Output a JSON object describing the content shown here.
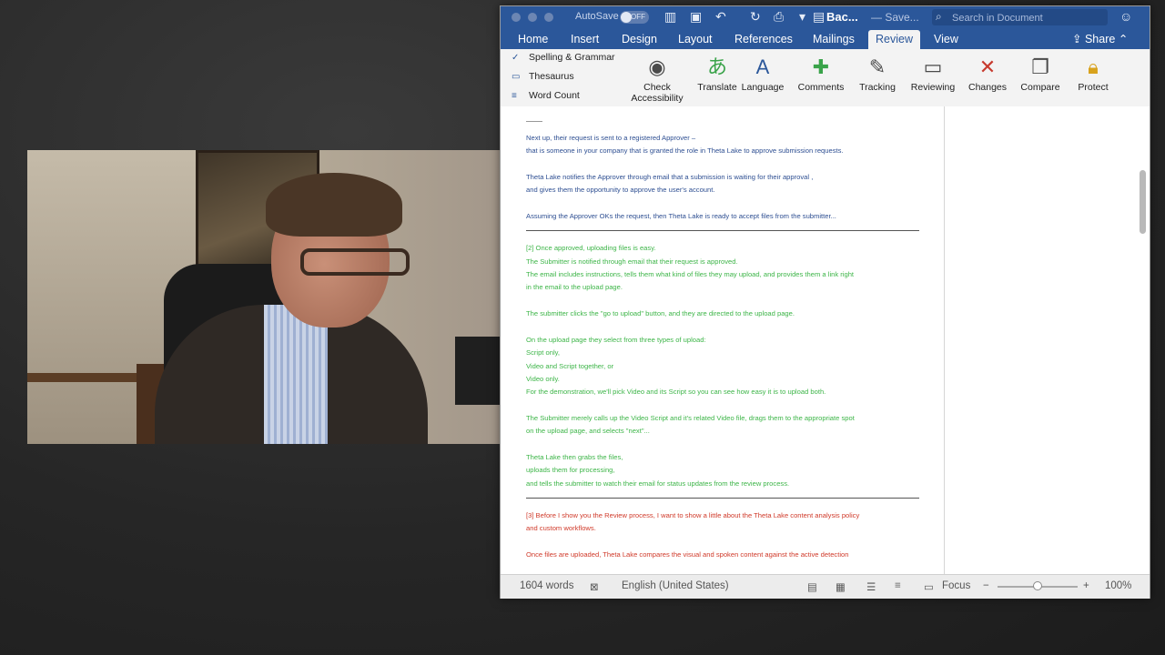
{
  "titlebar": {
    "autosave_label": "AutoSave",
    "autosave_state": "OFF",
    "doc_title": "Bac...",
    "doc_status": "— Save...",
    "search_placeholder": "Search in Document"
  },
  "tabs": [
    {
      "label": "Home"
    },
    {
      "label": "Insert"
    },
    {
      "label": "Design"
    },
    {
      "label": "Layout"
    },
    {
      "label": "References"
    },
    {
      "label": "Mailings"
    },
    {
      "label": "Review"
    },
    {
      "label": "View"
    }
  ],
  "share_label": "Share",
  "proofing": {
    "spelling": "Spelling & Grammar",
    "thesaurus": "Thesaurus",
    "word_count": "Word Count"
  },
  "ribbon": {
    "check_accessibility_1": "Check",
    "check_accessibility_2": "Accessibility",
    "translate": "Translate",
    "language": "Language",
    "comments": "Comments",
    "tracking": "Tracking",
    "reviewing": "Reviewing",
    "changes": "Changes",
    "compare": "Compare",
    "protect": "Protect"
  },
  "document": {
    "blue": [
      "Next up, their request is sent to a registered Approver –",
      "that is someone in your company that is granted the role in Theta Lake to approve submission requests.",
      "Theta Lake notifies the Approver through email that a submission is waiting for their approval ,",
      "and gives them the opportunity to approve the user's account.",
      "Assuming the Approver OKs the request, then Theta Lake is ready to accept files from the submitter..."
    ],
    "green": [
      "[2] Once approved, uploading files is easy.",
      "The Submitter is notified through email that their request is approved.",
      "The email includes instructions, tells them what kind of files they may upload, and provides them a link right",
      "in the email to the upload page.",
      "The submitter clicks the \"go to upload\" button, and they are directed to the upload page.",
      "On the upload page they select from three types of upload:",
      "Script only,",
      "Video and Script together, or",
      "Video only.",
      "For the demonstration, we'll pick Video and its Script so you can see how easy it is to upload both.",
      "The Submitter merely calls up the Video Script and it's related Video file, drags them to the appropriate spot",
      "on the upload page, and selects \"next\"...",
      "Theta Lake then grabs the files,",
      "uploads them for processing,",
      "and tells the submitter to watch their email for status updates from the review process."
    ],
    "red": [
      "[3] Before I show you the Review process, I want to show a little about the Theta Lake content analysis policy",
      "and custom workflows.",
      "Once files are uploaded, Theta Lake compares the visual and spoken content against the active detection"
    ]
  },
  "statusbar": {
    "word_count": "1604 words",
    "language": "English (United States)",
    "focus": "Focus",
    "zoom": "100%",
    "zoom_level": 0.5
  },
  "colors": {
    "titlebar": "#2b579a",
    "blue_text": "#2e4f92",
    "green_text": "#3db548",
    "red_text": "#d03a2a"
  }
}
